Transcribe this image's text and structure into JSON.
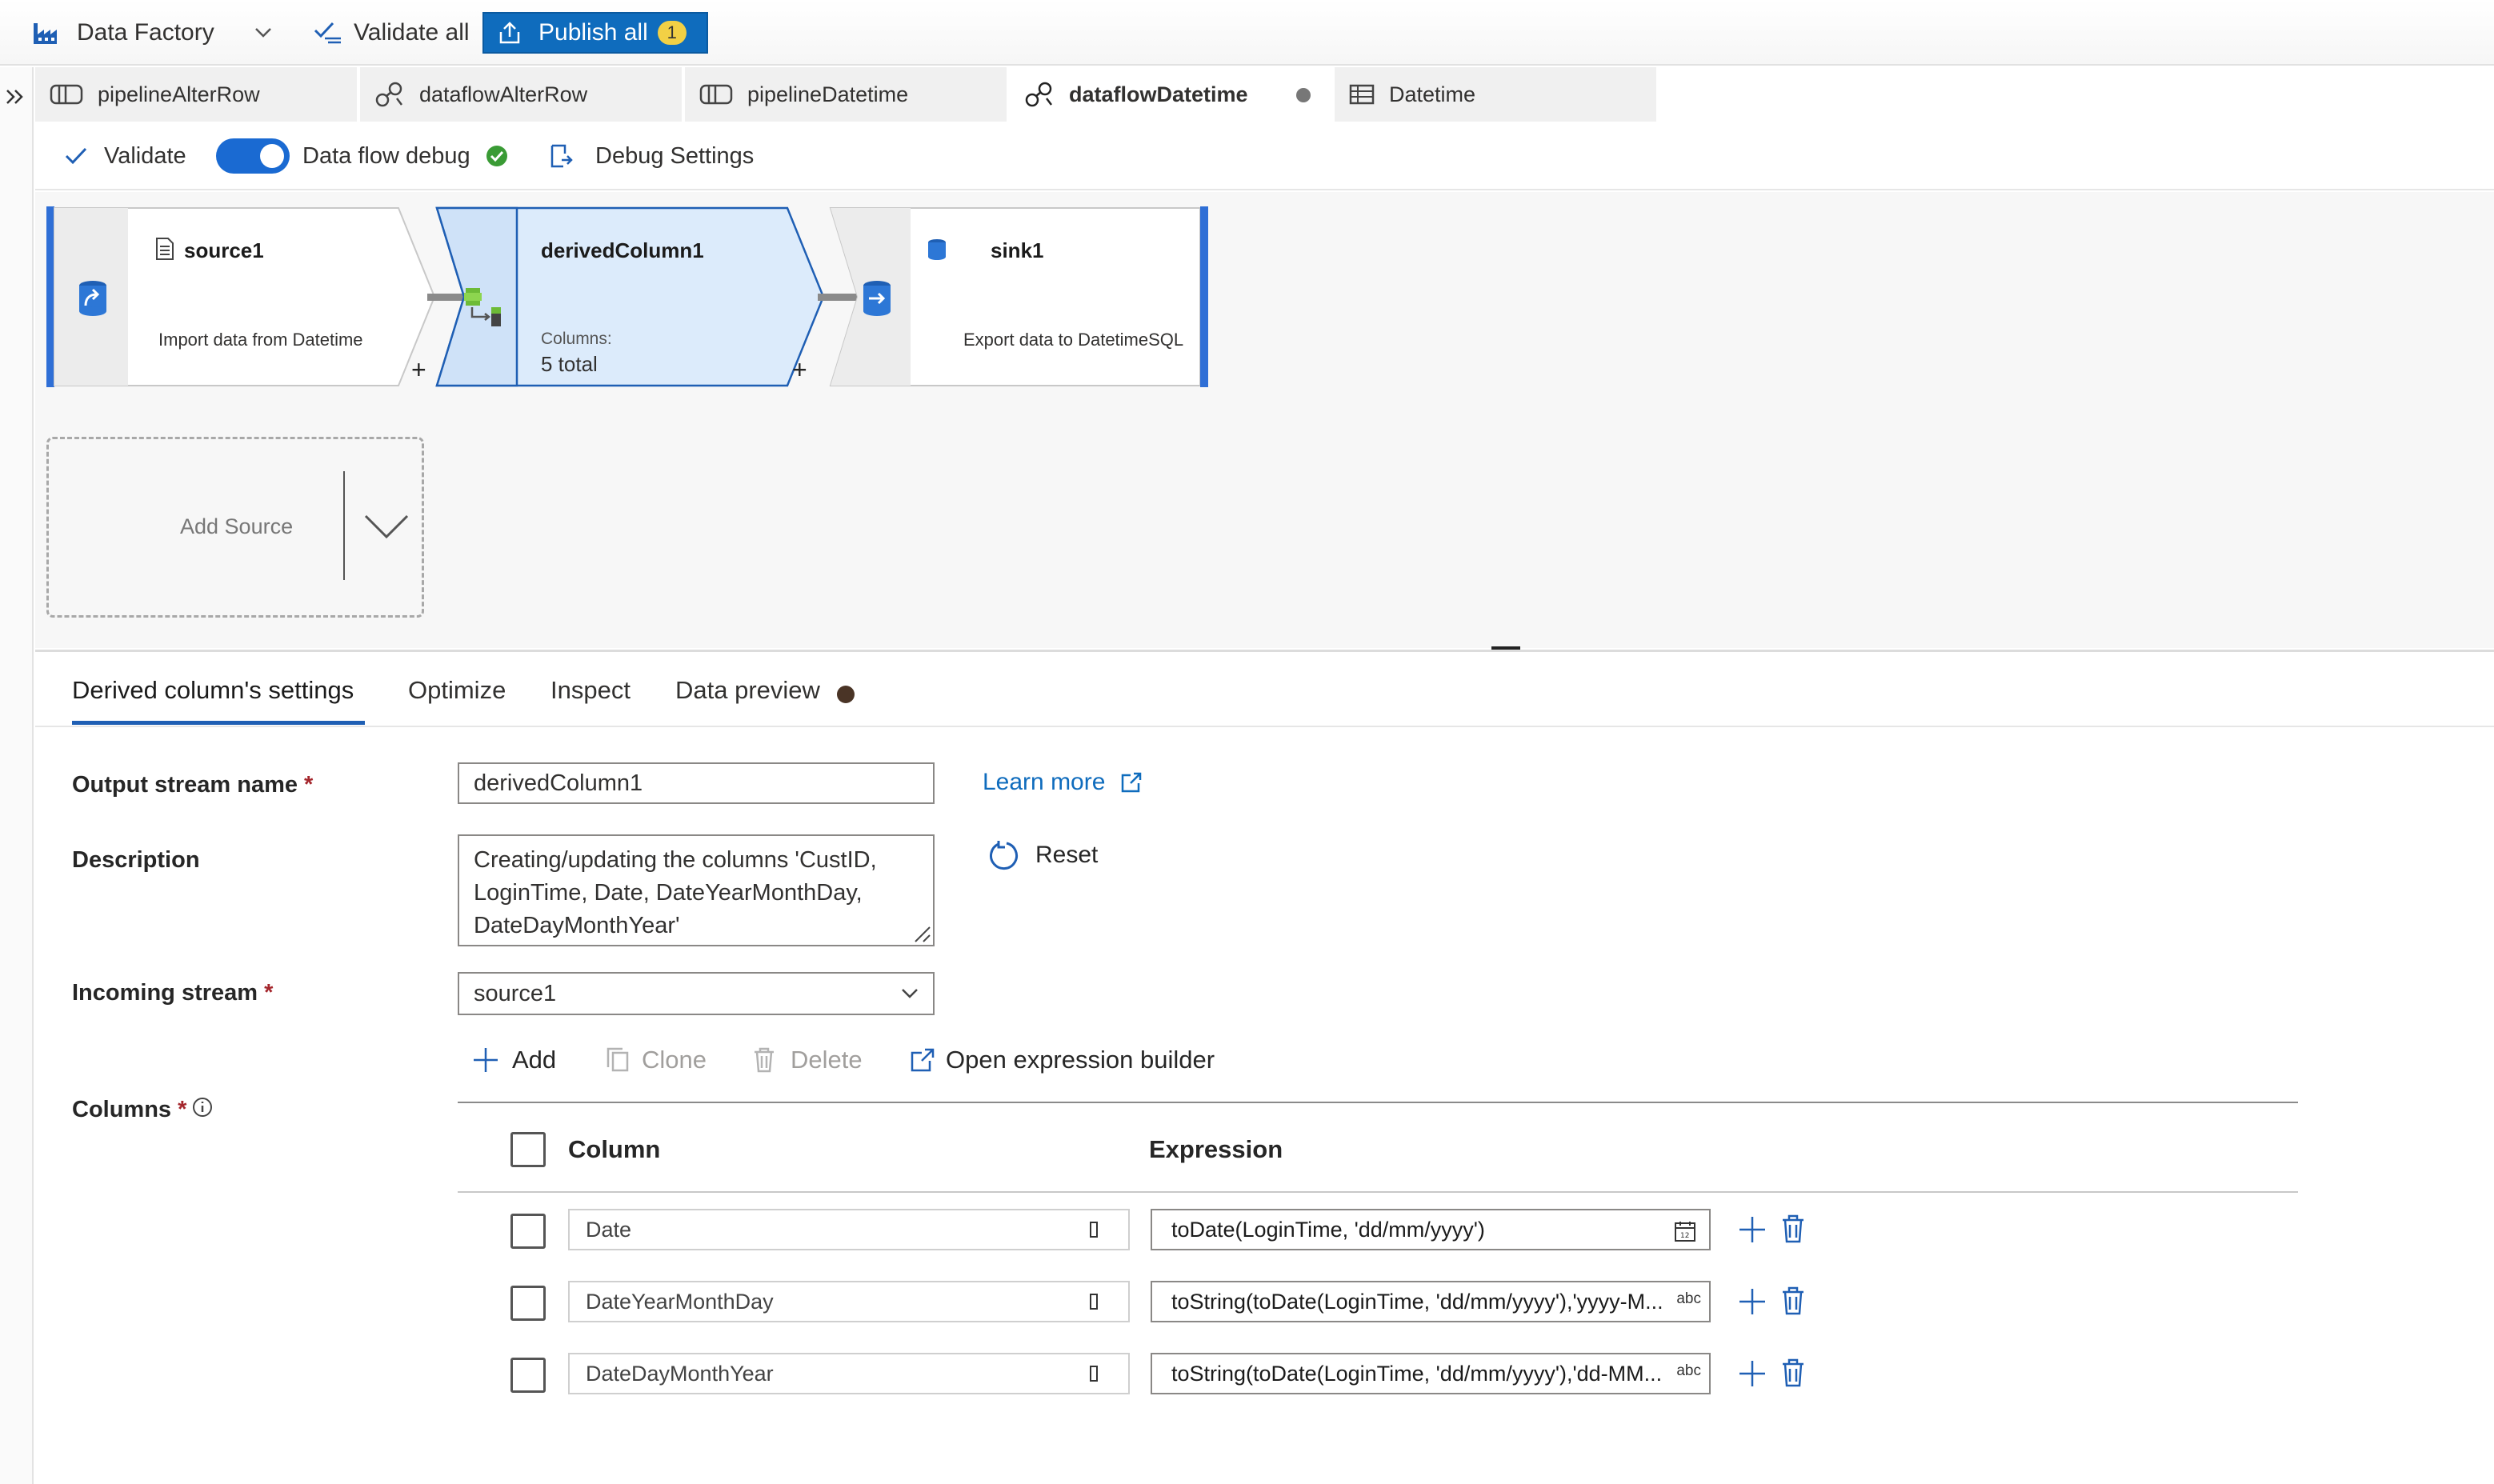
{
  "topbar": {
    "app_name": "Data Factory",
    "validate_all": "Validate all",
    "publish_all": "Publish all",
    "publish_count": "1",
    "brand_color": "#0f6cbd"
  },
  "tabs": [
    {
      "label": "pipelineAlterRow",
      "icon": "pipeline-icon"
    },
    {
      "label": "dataflowAlterRow",
      "icon": "dataflow-icon"
    },
    {
      "label": "pipelineDatetime",
      "icon": "pipeline-icon"
    },
    {
      "label": "dataflowDatetime",
      "icon": "dataflow-icon",
      "active": true,
      "unsaved": true
    },
    {
      "label": "Datetime",
      "icon": "table-icon"
    }
  ],
  "subbar": {
    "validate": "Validate",
    "debug_label": "Data flow debug",
    "debug_on": true,
    "debug_settings": "Debug Settings"
  },
  "canvas": {
    "source": {
      "title": "source1",
      "desc": "Import data from Datetime"
    },
    "derived": {
      "title": "derivedColumn1",
      "columns_label": "Columns:",
      "columns_value": "5 total"
    },
    "sink": {
      "title": "sink1",
      "desc": "Export data to DatetimeSQL"
    },
    "add_source": "Add Source",
    "plus": "+"
  },
  "props": {
    "tabs": [
      "Derived column's settings",
      "Optimize",
      "Inspect",
      "Data preview"
    ],
    "output_stream_label": "Output stream name",
    "output_stream_value": "derivedColumn1",
    "learn_more": "Learn more",
    "description_label": "Description",
    "description_value": "Creating/updating the columns 'CustID, LoginTime, Date, DateYearMonthDay, DateDayMonthYear'",
    "reset": "Reset",
    "incoming_label": "Incoming stream",
    "incoming_value": "source1",
    "columns_label": "Columns",
    "required": "*",
    "actions": {
      "add": "Add",
      "clone": "Clone",
      "delete": "Delete",
      "open_builder": "Open expression builder"
    },
    "grid_headers": {
      "column": "Column",
      "expression": "Expression"
    },
    "rows": [
      {
        "column": "Date",
        "expression": "toDate(LoginTime, 'dd/mm/yyyy')",
        "type": "date"
      },
      {
        "column": "DateYearMonthDay",
        "expression": "toString(toDate(LoginTime, 'dd/mm/yyyy'),'yyyy-M...",
        "type": "abc"
      },
      {
        "column": "DateDayMonthYear",
        "expression": "toString(toDate(LoginTime, 'dd/mm/yyyy'),'dd-MM...",
        "type": "abc"
      }
    ]
  }
}
